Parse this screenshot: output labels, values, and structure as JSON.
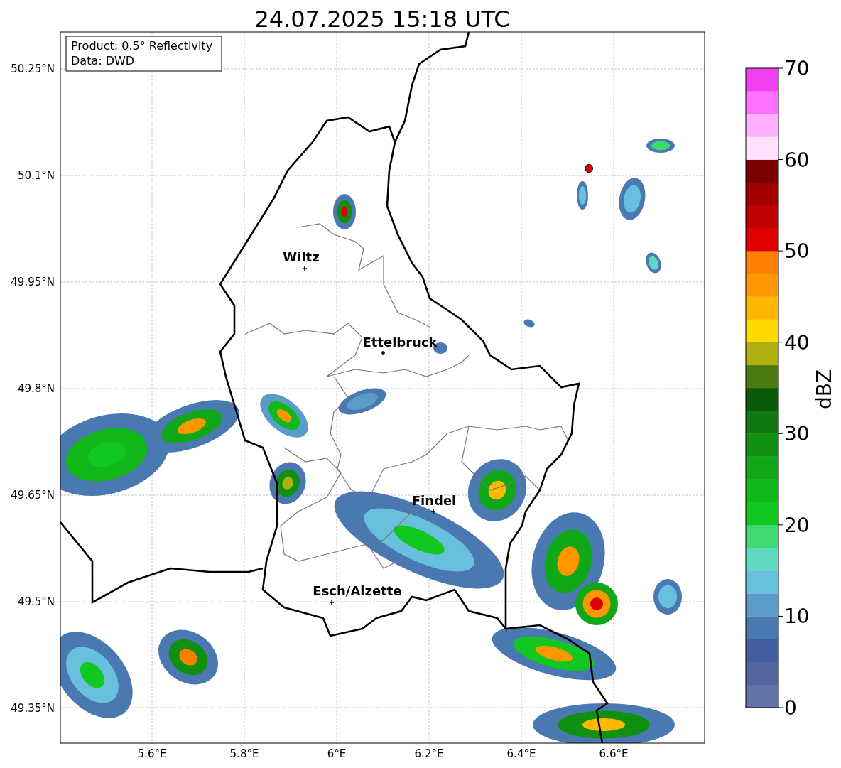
{
  "title": "24.07.2025 15:18 UTC",
  "info_box": {
    "lines": [
      "Product: 0.5° Reflectivity",
      "Data: DWD"
    ]
  },
  "lat_ticks": [
    "50.25°N",
    "50.1°N",
    "49.95°N",
    "49.8°N",
    "49.65°N",
    "49.5°N",
    "49.35°N"
  ],
  "lon_ticks": [
    "5.6°E",
    "5.8°E",
    "6°E",
    "6.2°E",
    "6.4°E",
    "6.6°E"
  ],
  "cities": [
    {
      "name": "Wiltz"
    },
    {
      "name": "Ettelbruck"
    },
    {
      "name": "Findel"
    },
    {
      "name": "Esch/Alzette"
    }
  ],
  "colorbar": {
    "label": "dBZ",
    "ticks": [
      "70",
      "60",
      "50",
      "40",
      "30",
      "20",
      "10",
      "0"
    ],
    "segments": [
      {
        "color": "#6474a8"
      },
      {
        "color": "#5465a0"
      },
      {
        "color": "#4460a5"
      },
      {
        "color": "#4a78b0"
      },
      {
        "color": "#5a9cc8"
      },
      {
        "color": "#68c0dc"
      },
      {
        "color": "#60d8c0"
      },
      {
        "color": "#40d870"
      },
      {
        "color": "#10c820"
      },
      {
        "color": "#10b818"
      },
      {
        "color": "#10a818"
      },
      {
        "color": "#109010"
      },
      {
        "color": "#107810"
      },
      {
        "color": "#0a5a0a"
      },
      {
        "color": "#4a7a10"
      },
      {
        "color": "#b0b010"
      },
      {
        "color": "#ffd800"
      },
      {
        "color": "#ffb800"
      },
      {
        "color": "#ff9800"
      },
      {
        "color": "#ff8000"
      },
      {
        "color": "#e00000"
      },
      {
        "color": "#c00000"
      },
      {
        "color": "#a00000"
      },
      {
        "color": "#7a0000"
      },
      {
        "color": "#ffe0ff"
      },
      {
        "color": "#ffb0ff"
      },
      {
        "color": "#ff70ff"
      },
      {
        "color": "#f040f0"
      }
    ]
  }
}
